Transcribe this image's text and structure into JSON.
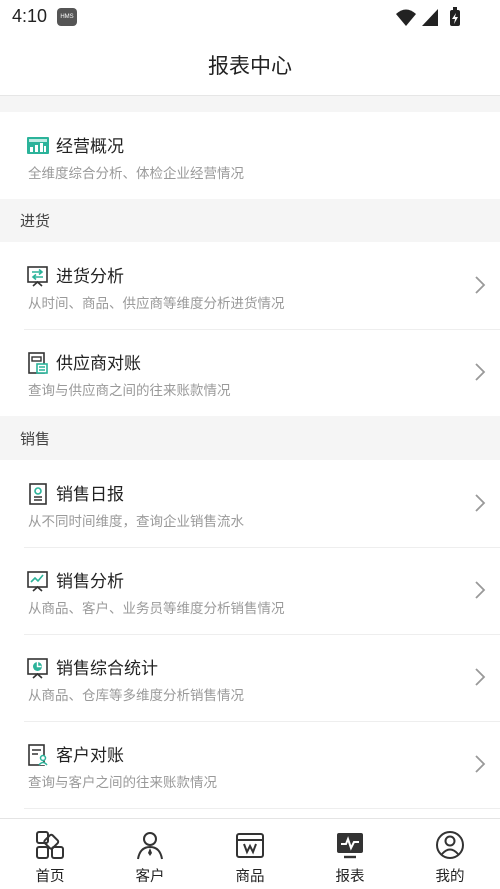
{
  "status_bar": {
    "time": "4:10",
    "badge": "HMS"
  },
  "header": {
    "title": "报表中心"
  },
  "overview": {
    "title": "经营概况",
    "desc": "全维度综合分析、体检企业经营情况"
  },
  "sections": {
    "purchase": {
      "label": "进货",
      "items": [
        {
          "title": "进货分析",
          "desc": "从时间、商品、供应商等维度分析进货情况"
        },
        {
          "title": "供应商对账",
          "desc": "查询与供应商之间的往来账款情况"
        }
      ]
    },
    "sales": {
      "label": "销售",
      "items": [
        {
          "title": "销售日报",
          "desc": "从不同时间维度，查询企业销售流水"
        },
        {
          "title": "销售分析",
          "desc": "从商品、客户、业务员等维度分析销售情况"
        },
        {
          "title": "销售综合统计",
          "desc": "从商品、仓库等多维度分析销售情况"
        },
        {
          "title": "客户对账",
          "desc": "查询与客户之间的往来账款情况"
        }
      ]
    }
  },
  "tabs": [
    {
      "label": "首页"
    },
    {
      "label": "客户"
    },
    {
      "label": "商品"
    },
    {
      "label": "报表"
    },
    {
      "label": "我的"
    }
  ],
  "colors": {
    "accent": "#2bb39a",
    "text": "#222222",
    "subtext": "#9a9a9a"
  }
}
